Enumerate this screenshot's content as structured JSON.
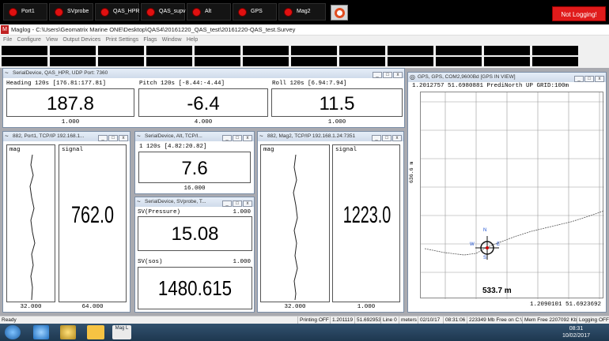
{
  "sensor_buttons": [
    {
      "label": "Port1"
    },
    {
      "label": "SVprobe"
    },
    {
      "label": "QAS_HPR"
    },
    {
      "label": "QAS_supv"
    },
    {
      "label": "Alt"
    },
    {
      "label": "GPS"
    },
    {
      "label": "Mag2"
    }
  ],
  "logging_status": "Not Logging!",
  "window_title": "Maglog - C:\\Users\\Geomatrix Marine ONE\\Desktop\\QAS4\\20161220_QAS_test\\20161220-QAS_test.Survey",
  "menu": [
    "File",
    "Configure",
    "View",
    "Output Devices",
    "Print Settings",
    "Flags",
    "Window",
    "Help"
  ],
  "hpr": {
    "title": "SerialDevice, QAS_HPR, UDP Port: 7360",
    "heading_label": "Heading  120s [176.81:177.81]",
    "heading_value": "187.8",
    "heading_foot": "1.000",
    "pitch_label": "Pitch  120s [-8.44:-4.44]",
    "pitch_value": "-6.4",
    "pitch_foot": "4.000",
    "roll_label": "Roll  120s [6.94:7.94]",
    "roll_value": "11.5",
    "roll_foot": "1.000"
  },
  "port1": {
    "title": "882, Port1, TCP/IP 192.168.1...",
    "mag_label": "mag",
    "signal_label": "signal",
    "value": "762.0",
    "foot_left": "32.000",
    "foot_right": "64.000"
  },
  "alt": {
    "title": "SerialDevice, Alt, TCP/I...",
    "label": "1  120s [4.82:20.82]",
    "value": "7.6",
    "foot": "16.000"
  },
  "svprobe": {
    "title": "SerialDevice, SVprobe, T...",
    "pressure_label": "SV(Pressure)",
    "pressure_scale": "1.000",
    "pressure_value": "15.08",
    "sos_label": "SV(sos)",
    "sos_scale": "1.000",
    "sos_value": "1480.615"
  },
  "mag2": {
    "title": "882, Mag2, TCP/IP 192.168.1.24:7351",
    "mag_label": "mag",
    "signal_label": "signal",
    "value": "1223.0",
    "foot_left": "32.000",
    "foot_right": "1.000"
  },
  "gps": {
    "title": "GPS, GPS, COM2,9600Bd [GPS IN VIEW]",
    "header": "1.2012757 51.6980881 PrediNorth UP GRID:100m",
    "side_label": "636.6 m",
    "scale_label": "533.7 m",
    "coords": "1.2090101 51.6923692",
    "compass": {
      "n": "N",
      "s": "S",
      "e": "E",
      "w": "W"
    }
  },
  "status": {
    "ready": "Ready",
    "printing": "Printing OFF",
    "lon": "1.201119",
    "lat": "51.692953",
    "line": "Line 0",
    "units": "meters",
    "date": "02/10/17",
    "time": "08:31:06",
    "disk": "223349 Mb Free on C:\\",
    "mem": "Mem Free 2207092 Kb",
    "logging": "Logging OFF"
  },
  "taskbar": {
    "time": "08:31",
    "date": "10/02/2017",
    "maglog_label": "Mag L"
  }
}
